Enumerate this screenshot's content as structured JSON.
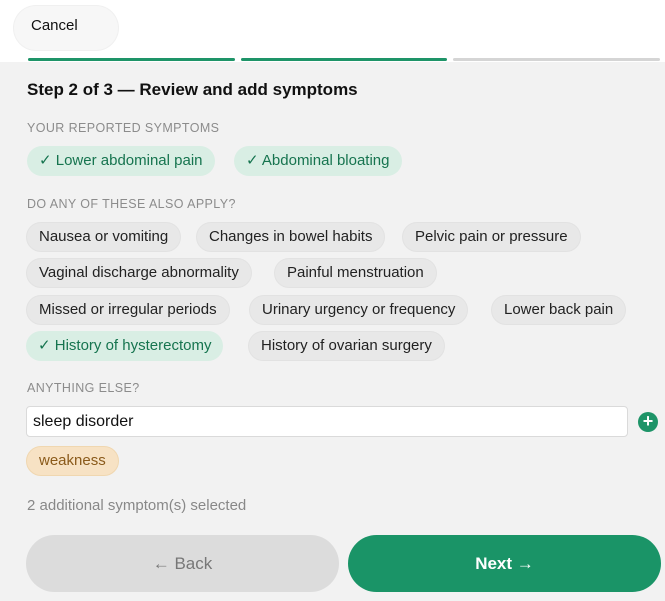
{
  "header": {
    "cancel_label": "Cancel"
  },
  "progress": {
    "steps_total": 3,
    "steps_done": 2
  },
  "step_title": "Step 2 of 3 — Review and add symptoms",
  "reported": {
    "label": "YOUR REPORTED SYMPTOMS",
    "items": [
      "✓ Lower abdominal pain",
      "✓ Abdominal bloating"
    ]
  },
  "also_apply": {
    "label": "DO ANY OF THESE ALSO APPLY?",
    "options": [
      "Nausea or vomiting",
      "Changes in bowel habits",
      "Pelvic pain or pressure",
      "Vaginal discharge abnormality",
      "Painful menstruation",
      "Missed or irregular periods",
      "Urinary urgency or frequency",
      "Lower back pain",
      "✓ History of hysterectomy",
      "History of ovarian surgery"
    ],
    "selected": [
      "History of hysterectomy"
    ]
  },
  "anything_else": {
    "label": "ANYTHING ELSE?",
    "input_value": "sleep disorder",
    "add_icon": "plus-circle-icon",
    "custom_chips": [
      "weakness"
    ]
  },
  "summary_text": "2 additional symptom(s) selected",
  "footer": {
    "back_label": "← Back",
    "next_label": "Next →"
  },
  "colors": {
    "accent": "#1a9467",
    "selected_bg": "#d9eee4",
    "custom_bg": "#f7e2c4"
  }
}
